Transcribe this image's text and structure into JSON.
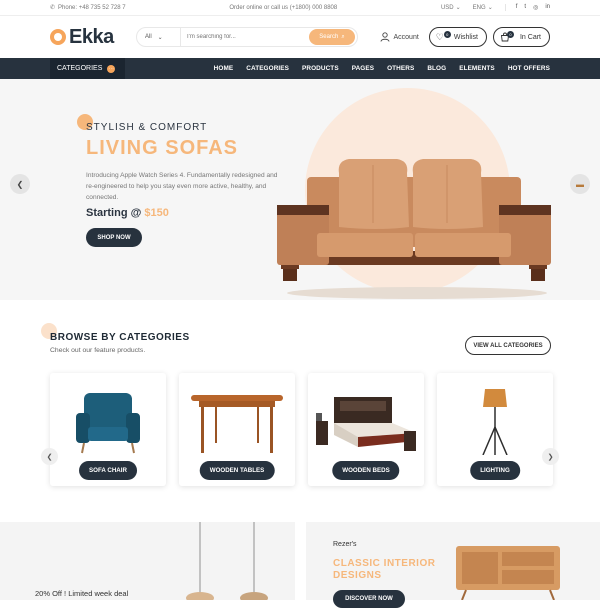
{
  "topbar": {
    "phone": "Phone: +48 735 52 728 7",
    "promo": "Order online or call us (+1800) 000 8808",
    "currency": "USD",
    "language": "ENG",
    "social_icons": [
      "facebook-icon",
      "twitter-icon",
      "instagram-icon",
      "linkedin-icon"
    ],
    "social_glyphs": [
      "f",
      "t",
      "◎",
      "in"
    ]
  },
  "header": {
    "logo": "Ekka",
    "search_category": "All",
    "search_placeholder": "I'm searching for...",
    "search_button": "Search",
    "account": "Account",
    "wishlist": "Wishlist",
    "wishlist_count": "0",
    "cart": "In Cart",
    "cart_count": "0"
  },
  "nav": {
    "categories": "CATEGORIES",
    "links": [
      "HOME",
      "CATEGORIES",
      "PRODUCTS",
      "PAGES",
      "OTHERS",
      "BLOG",
      "ELEMENTS",
      "HOT OFFERS"
    ]
  },
  "hero": {
    "eyebrow": "STYLISH & COMFORT",
    "title": "LIVING SOFAS",
    "description": "Introducing Apple Watch Series 4. Fundamentally redesigned and re-engineered to help you stay even more active, healthy, and connected.",
    "price_label": "Starting @",
    "price": "$150",
    "cta": "SHOP NOW"
  },
  "categories": {
    "heading": "BROWSE BY CATEGORIES",
    "subheading": "Check out our feature products.",
    "view_all": "VIEW ALL CATEGORIES",
    "items": [
      {
        "label": "SOFA CHAIR"
      },
      {
        "label": "WOODEN TABLES"
      },
      {
        "label": "WOODEN BEDS"
      },
      {
        "label": "LIGHTING"
      }
    ]
  },
  "banners": {
    "left_offer": "20% Off ! Limited week deal",
    "right_brand": "Rezer's",
    "right_title": "CLASSIC INTERIOR DESIGNS",
    "right_cta": "DISCOVER NOW"
  },
  "colors": {
    "accent": "#f6b77b",
    "dark": "#27323e"
  }
}
